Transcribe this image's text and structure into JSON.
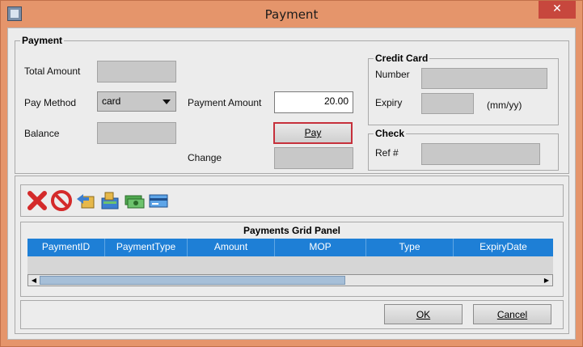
{
  "window": {
    "title": "Payment",
    "close_glyph": "✕"
  },
  "payment": {
    "legend": "Payment",
    "total_amount_label": "Total Amount",
    "total_amount_value": "",
    "pay_method_label": "Pay Method",
    "pay_method_value": "card",
    "balance_label": "Balance",
    "balance_value": "",
    "payment_amount_label": "Payment Amount",
    "payment_amount_value": "20.00",
    "pay_button_label": "Pay",
    "change_label": "Change",
    "change_value": ""
  },
  "credit_card": {
    "legend": "Credit Card",
    "number_label": "Number",
    "number_value": "",
    "expiry_label": "Expiry",
    "expiry_value": "",
    "expiry_hint": "(mm/yy)"
  },
  "check": {
    "legend": "Check",
    "ref_label": "Ref #",
    "ref_value": ""
  },
  "toolbar": {
    "icons": [
      "delete-icon",
      "cancel-icon",
      "back-icon",
      "payment-icon",
      "cash-icon",
      "card-icon"
    ]
  },
  "grid": {
    "title": "Payments Grid Panel",
    "columns": [
      "PaymentID",
      "PaymentType",
      "Amount",
      "MOP",
      "Type",
      "ExpiryDate"
    ],
    "rows": []
  },
  "footer": {
    "ok_label": "OK",
    "cancel_label": "Cancel"
  },
  "colors": {
    "title_bar": "#e5956b",
    "close_button": "#c7473d",
    "grid_header": "#1e7fd6",
    "pay_border": "#c6303b"
  }
}
